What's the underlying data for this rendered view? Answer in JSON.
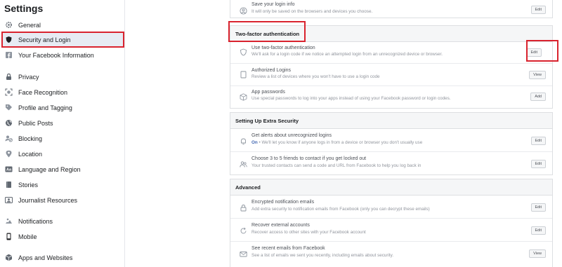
{
  "sidebar": {
    "title": "Settings",
    "items": [
      {
        "label": "General"
      },
      {
        "label": "Security and Login"
      },
      {
        "label": "Your Facebook Information"
      },
      {
        "label": "Privacy"
      },
      {
        "label": "Face Recognition"
      },
      {
        "label": "Profile and Tagging"
      },
      {
        "label": "Public Posts"
      },
      {
        "label": "Blocking"
      },
      {
        "label": "Location"
      },
      {
        "label": "Language and Region"
      },
      {
        "label": "Stories"
      },
      {
        "label": "Journalist Resources"
      },
      {
        "label": "Notifications"
      },
      {
        "label": "Mobile"
      },
      {
        "label": "Apps and Websites"
      }
    ]
  },
  "top_row": {
    "title": "Save your login info",
    "desc": "It will only be saved on the browsers and devices you choose.",
    "button": "Edit"
  },
  "two_factor": {
    "header": "Two-factor authentication",
    "rows": [
      {
        "title": "Use two-factor authentication",
        "desc": "We'll ask for a login code if we notice an attempted login from an unrecognized device or browser.",
        "button": "Edit"
      },
      {
        "title": "Authorized Logins",
        "desc": "Review a list of devices where you won't have to use a login code",
        "button": "View"
      },
      {
        "title": "App passwords",
        "desc": "Use special passwords to log into your apps instead of using your Facebook password or login codes.",
        "button": "Add"
      }
    ]
  },
  "extra_security": {
    "header": "Setting Up Extra Security",
    "rows": [
      {
        "title": "Get alerts about unrecognized logins",
        "desc_on": "On",
        "desc": " • We'll let you know if anyone logs in from a device or browser you don't usually use",
        "button": "Edit"
      },
      {
        "title": "Choose 3 to 5 friends to contact if you get locked out",
        "desc": "Your trusted contacts can send a code and URL from Facebook to help you log back in",
        "button": "Edit"
      }
    ]
  },
  "advanced": {
    "header": "Advanced",
    "rows": [
      {
        "title": "Encrypted notification emails",
        "desc": "Add extra security to notification emails from Facebook (only you can decrypt these emails)",
        "button": "Edit"
      },
      {
        "title": "Recover external accounts",
        "desc": "Recover access to other sites with your Facebook account",
        "button": "Edit"
      },
      {
        "title": "See recent emails from Facebook",
        "desc": "See a list of emails we sent you recently, including emails about security.",
        "button": "View"
      }
    ]
  },
  "colors": {
    "highlight": "#d9232e",
    "link_blue": "#4267b2",
    "panel_header_bg": "#f5f6f7"
  }
}
